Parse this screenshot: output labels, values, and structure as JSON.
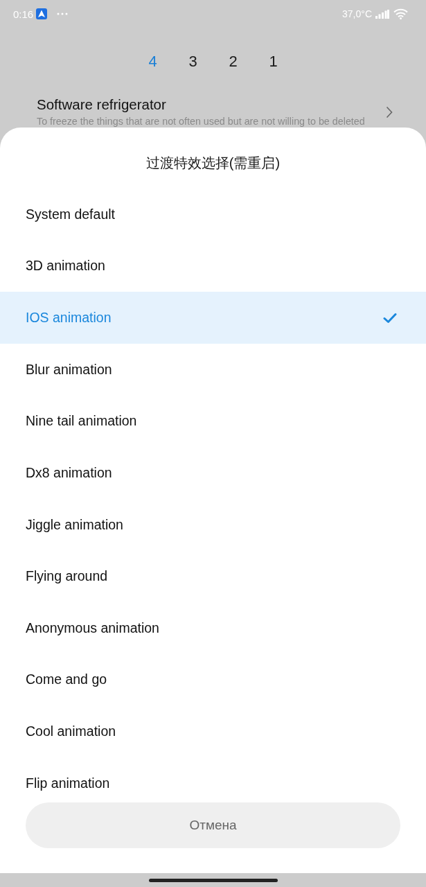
{
  "status_bar": {
    "time": "0:16",
    "temperature": "37,0°C"
  },
  "tabs": [
    {
      "label": "4",
      "selected": true
    },
    {
      "label": "3",
      "selected": false
    },
    {
      "label": "2",
      "selected": false
    },
    {
      "label": "1",
      "selected": false
    }
  ],
  "setting": {
    "title": "Software refrigerator",
    "subtitle": "To freeze the things that are not often used but are not willing to be deleted"
  },
  "sheet": {
    "title": "过渡特效选择(需重启)",
    "options": [
      {
        "label": "System default",
        "selected": false
      },
      {
        "label": "3D animation",
        "selected": false
      },
      {
        "label": "IOS animation",
        "selected": true
      },
      {
        "label": "Blur animation",
        "selected": false
      },
      {
        "label": "Nine tail animation",
        "selected": false
      },
      {
        "label": "Dx8 animation",
        "selected": false
      },
      {
        "label": "Jiggle animation",
        "selected": false
      },
      {
        "label": "Flying around",
        "selected": false
      },
      {
        "label": "Anonymous animation",
        "selected": false
      },
      {
        "label": "Come and go",
        "selected": false
      },
      {
        "label": "Cool animation",
        "selected": false
      },
      {
        "label": "Flip animation",
        "selected": false
      }
    ],
    "cancel_button": "Отмена"
  }
}
